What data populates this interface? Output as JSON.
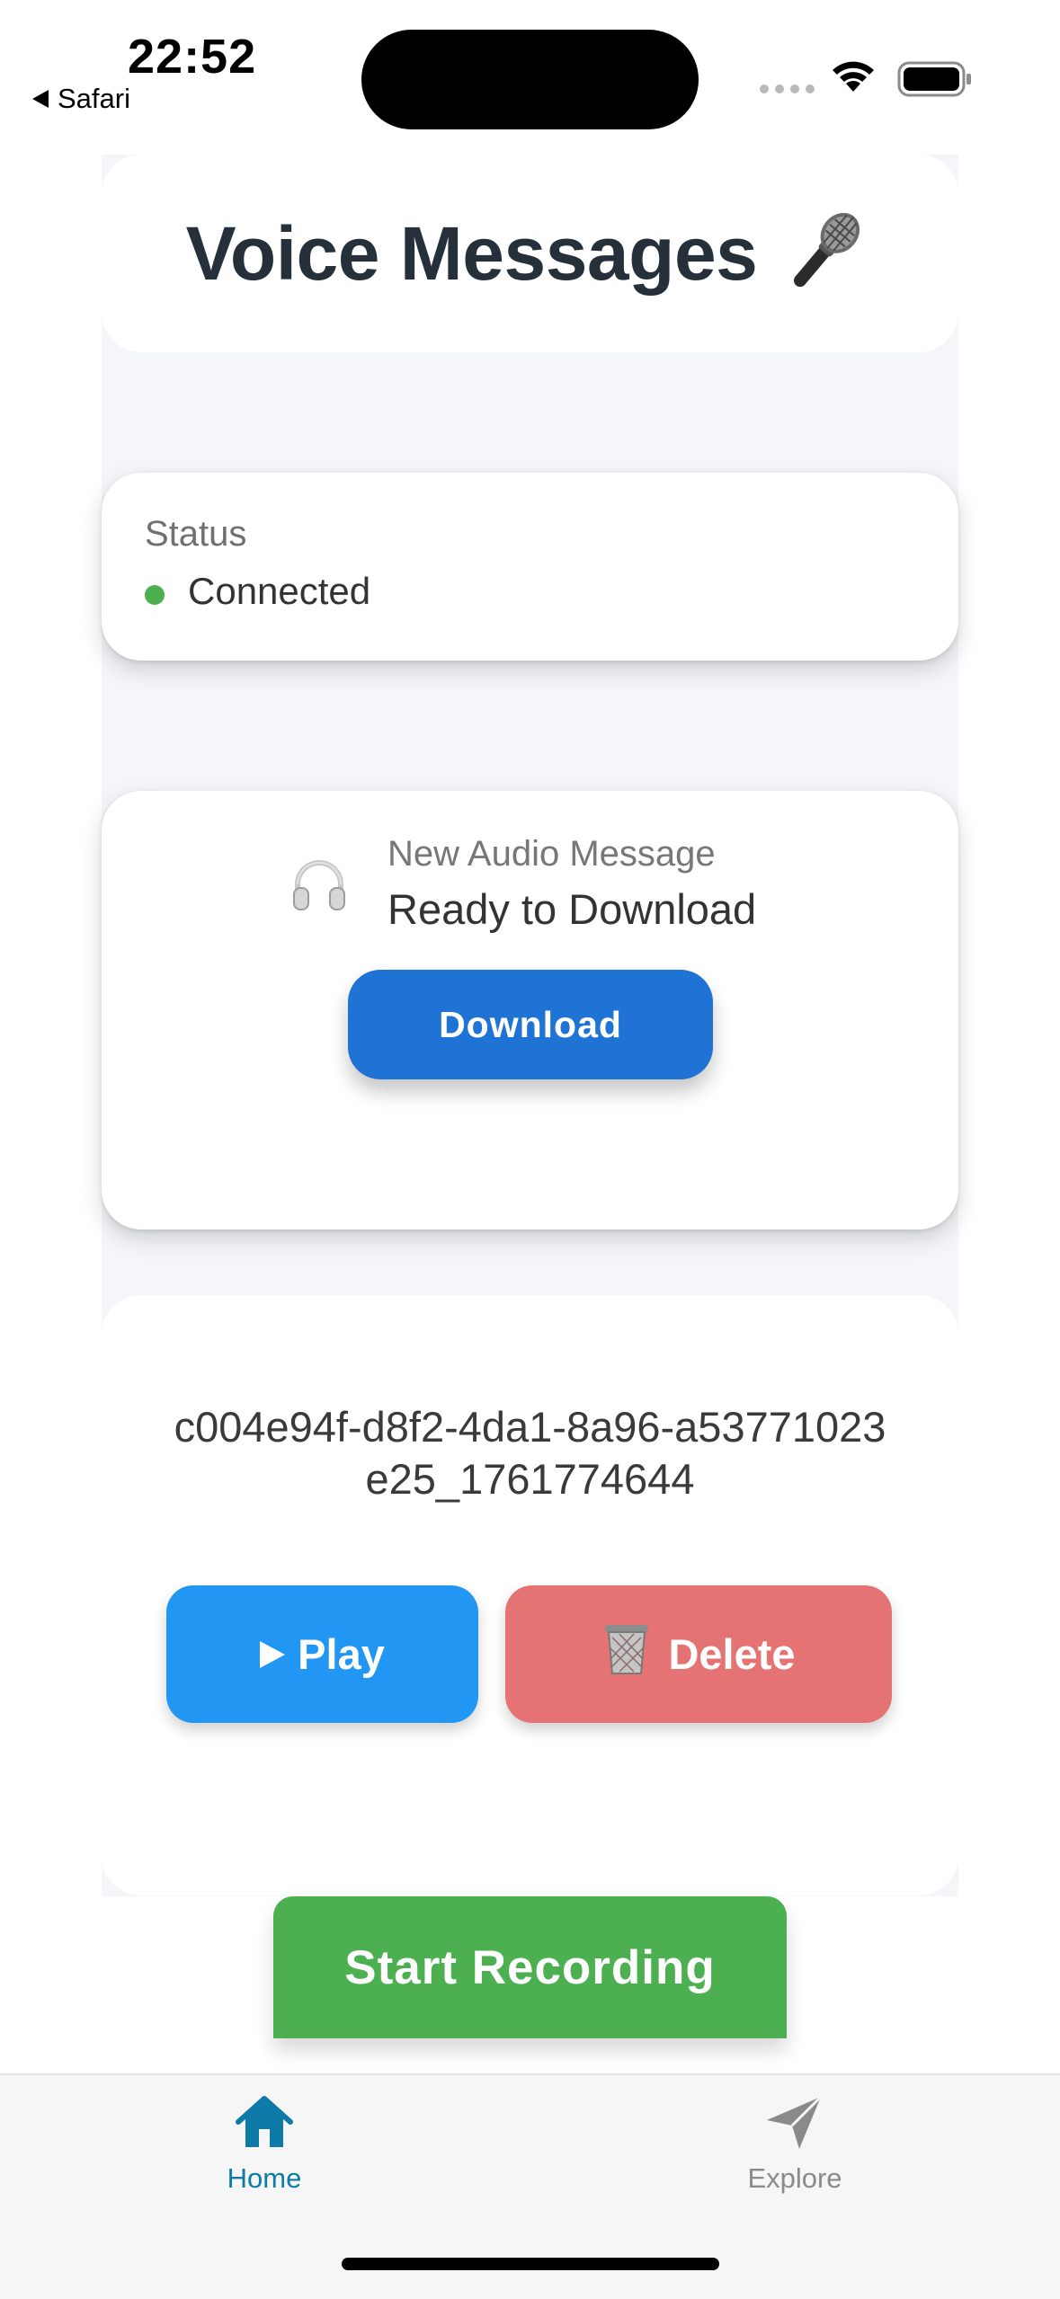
{
  "status_bar": {
    "time": "22:52",
    "back_app": "Safari"
  },
  "header": {
    "title": "Voice Messages",
    "title_emoji": "🎤"
  },
  "status": {
    "label": "Status",
    "value": "Connected",
    "dot_color": "#4caf50"
  },
  "audio_notice": {
    "icon": "headphones-icon",
    "subtitle": "New Audio Message",
    "title": "Ready to Download",
    "download_label": "Download"
  },
  "message": {
    "id": "c004e94f-d8f2-4da1-8a96-a53771023e25_1761774644",
    "play_label": "Play",
    "delete_label": "Delete",
    "delete_emoji": "🗑️"
  },
  "record": {
    "label": "Start Recording"
  },
  "tabs": [
    {
      "label": "Home",
      "icon": "home-icon",
      "active": true
    },
    {
      "label": "Explore",
      "icon": "send-icon",
      "active": false
    }
  ],
  "colors": {
    "accent_blue": "#1e73d4",
    "play_blue": "#2196f3",
    "delete_red": "#e57373",
    "record_green": "#4caf50",
    "tab_active": "#0d7aa8"
  }
}
